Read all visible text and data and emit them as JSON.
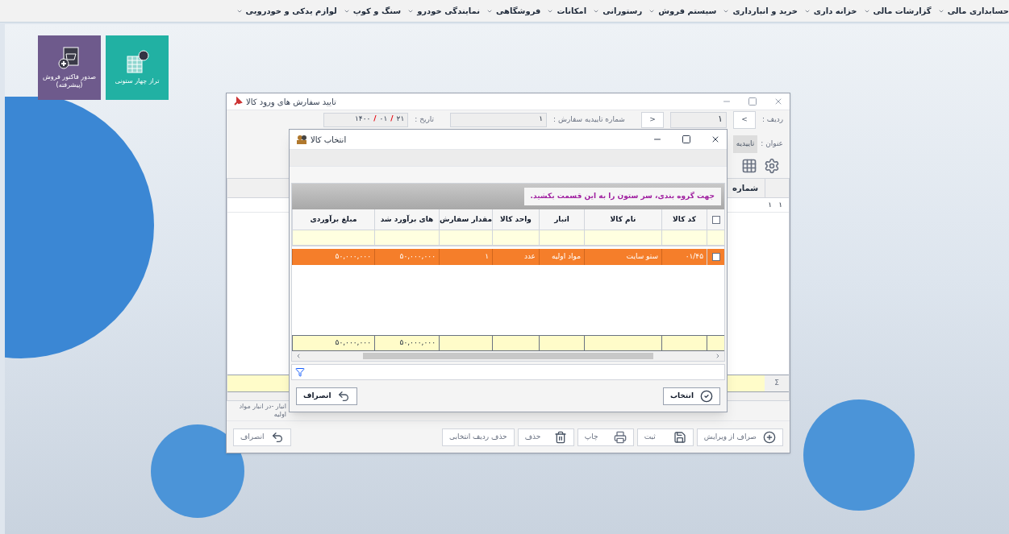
{
  "menu_bar": {
    "items": [
      "حسابداری مالی",
      "گزارشات مالی",
      "خزانه داری",
      "خرید و انبارداری",
      "سیستم فروش",
      "رستورانی",
      "امکانات",
      "فروشگاهی",
      "نمایندگی خودرو",
      "سنگ و کوپ",
      "لوازم یدکی و خودرویی"
    ]
  },
  "tiles": [
    {
      "label": "تراز چهار ستونی",
      "color": "#21b1a3",
      "kind": "balance"
    },
    {
      "label": "صدور فاکتور فروش (پیشرفته)",
      "color": "#6e5a8c",
      "kind": "invoice"
    }
  ],
  "back_window": {
    "title": "تایید سفارش های ورود کالا",
    "row_label": "ردیف :",
    "next_button": ">",
    "row_value": "۱",
    "prev_button": "<",
    "order_no_label": "شماره تاییدیه سفارش :",
    "order_no_value": "۱",
    "date_label": "تاریخ :",
    "date_parts": [
      "۲۱",
      "۰۱",
      "۱۴۰۰"
    ],
    "date_separator": "/",
    "subject_label": "عنوان :",
    "subject_value": "تاییدیه",
    "grid_header": "شماره",
    "grid_row": [
      "۱",
      "۱"
    ],
    "sum_symbol": "Σ",
    "status": "انبار -در انبار مواد اولیه",
    "buttons": [
      {
        "label": "صراف از ویرایش",
        "kind": "add"
      },
      {
        "label": "ثبت",
        "kind": "save"
      },
      {
        "label": "چاپ",
        "kind": "print"
      },
      {
        "label": "حذف",
        "kind": "delete"
      },
      {
        "label": "حذف ردیف انتخابی",
        "kind": "plain"
      },
      {
        "label": "انصراف",
        "kind": "cancel"
      }
    ]
  },
  "dialog": {
    "title": "انتخاب کالا",
    "group_hint": "جهت گروه بندی، سر ستون را به این قسمت بکشید.",
    "header_checked": false,
    "columns": [
      "کد کالا",
      "نام کالا",
      "انبار",
      "واحد کالا",
      "مقدار سفارش",
      "های برآورد شد",
      "مبلغ برآوردی"
    ],
    "rows": [
      {
        "selected": true,
        "checked": false,
        "cells": [
          "۰۱/۴۵",
          "ستو سایت",
          "مواد اولیه",
          "عدد",
          "۱",
          "۵۰,۰۰۰,۰۰۰",
          "۵۰,۰۰۰,۰۰۰"
        ]
      }
    ],
    "totals": [
      "۵۰,۰۰۰,۰۰۰",
      "۵۰,۰۰۰,۰۰۰"
    ],
    "buttons": [
      {
        "label": "انتخاب",
        "kind": "select"
      },
      {
        "label": "انصراف",
        "kind": "cancel"
      }
    ]
  }
}
